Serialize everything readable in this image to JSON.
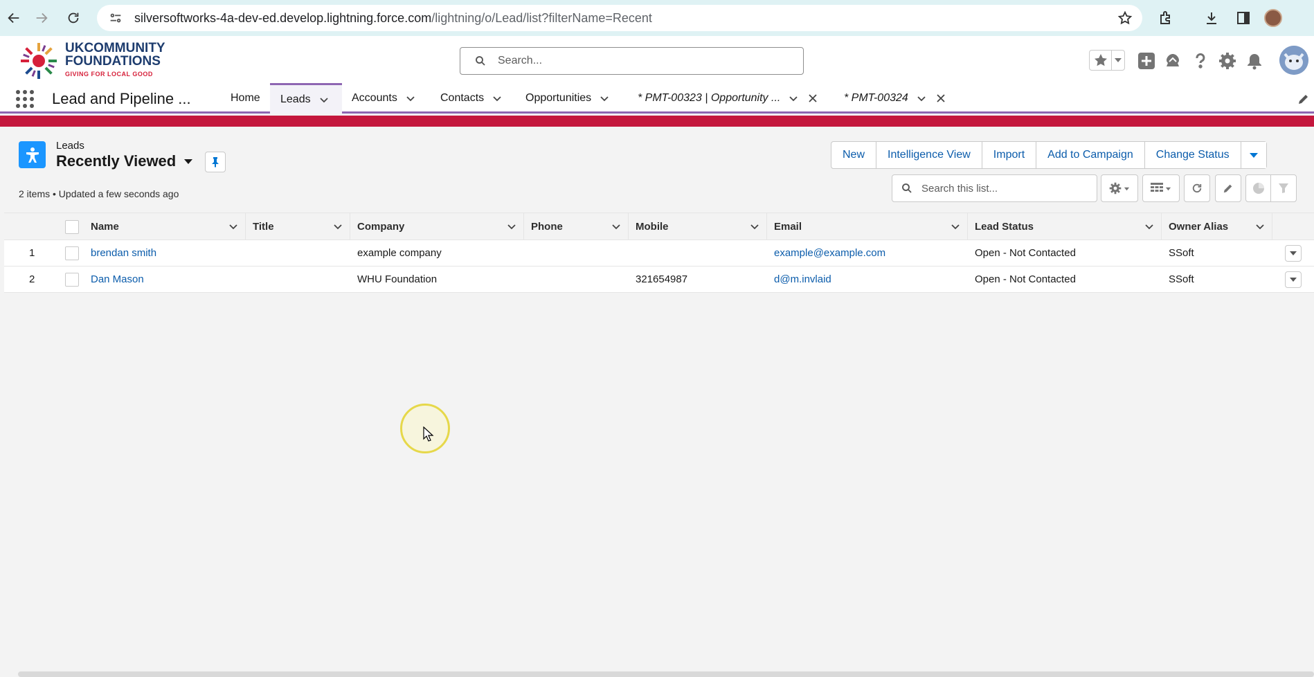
{
  "browser": {
    "url_host": "silversoftworks-4a-dev-ed.develop.lightning.force.com",
    "url_path": "/lightning/o/Lead/list?filterName=Recent"
  },
  "header": {
    "logo_line1": "UKCOMMUNITY",
    "logo_line2": "FOUNDATIONS",
    "logo_tagline": "GIVING FOR LOCAL GOOD",
    "search_placeholder": "Search..."
  },
  "nav": {
    "app_name": "Lead and Pipeline ...",
    "items": [
      {
        "label": "Home"
      },
      {
        "label": "Leads"
      },
      {
        "label": "Accounts"
      },
      {
        "label": "Contacts"
      },
      {
        "label": "Opportunities"
      },
      {
        "label": "* PMT-00323 | Opportunity ..."
      },
      {
        "label": "* PMT-00324"
      }
    ]
  },
  "list": {
    "object_label": "Leads",
    "title": "Recently Viewed",
    "meta": "2 items • Updated a few seconds ago",
    "buttons": [
      "New",
      "Intelligence View",
      "Import",
      "Add to Campaign",
      "Change Status"
    ],
    "search_placeholder": "Search this list..."
  },
  "table": {
    "columns": [
      "Name",
      "Title",
      "Company",
      "Phone",
      "Mobile",
      "Email",
      "Lead Status",
      "Owner Alias"
    ],
    "rows": [
      {
        "num": "1",
        "name": "brendan smith",
        "title": "",
        "company": "example company",
        "phone": "",
        "mobile": "",
        "email": "example@example.com",
        "status": "Open - Not Contacted",
        "owner": "SSoft"
      },
      {
        "num": "2",
        "name": "Dan Mason",
        "title": "",
        "company": "WHU Foundation",
        "phone": "",
        "mobile": "321654987",
        "email": "d@m.invlaid",
        "status": "Open - Not Contacted",
        "owner": "SSoft"
      }
    ]
  },
  "colors": {
    "accent": "#0176d3",
    "nav_underline": "#8e66b2",
    "banner": "#c4173d",
    "link": "#0b5cab"
  }
}
